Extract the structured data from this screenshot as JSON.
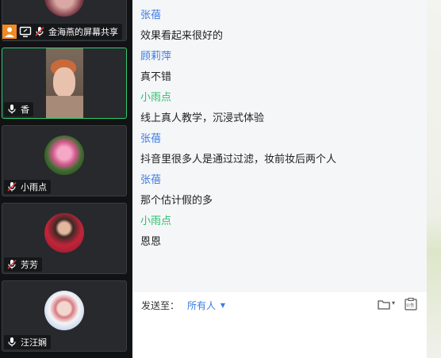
{
  "participants": [
    {
      "name": "金海燕的屏幕共享",
      "top": 0
    },
    {
      "name": "香"
    },
    {
      "name": "小雨点"
    },
    {
      "name": "芳芳"
    },
    {
      "name": "汪汪娴"
    }
  ],
  "chat": {
    "messages": [
      {
        "sender": "张蓓",
        "text": "效果看起来很好的"
      },
      {
        "sender": "顾莉萍",
        "text": "真不错"
      },
      {
        "sender": "小雨点",
        "text": "线上真人教学，沉浸式体验"
      },
      {
        "sender": "张蓓",
        "text": "抖音里很多人是通过过滤，妆前妆后两个人"
      },
      {
        "sender": "张蓓",
        "text": "那个估计假的多"
      },
      {
        "sender": "小雨点",
        "text": "恩恩"
      }
    ],
    "sender_colors": {
      "default": "#3a7be0",
      "小雨点": "#27c06a"
    }
  },
  "composer": {
    "send_to_label": "发送至：",
    "send_to_target": "所有人",
    "notice_icon_text": "公告"
  }
}
